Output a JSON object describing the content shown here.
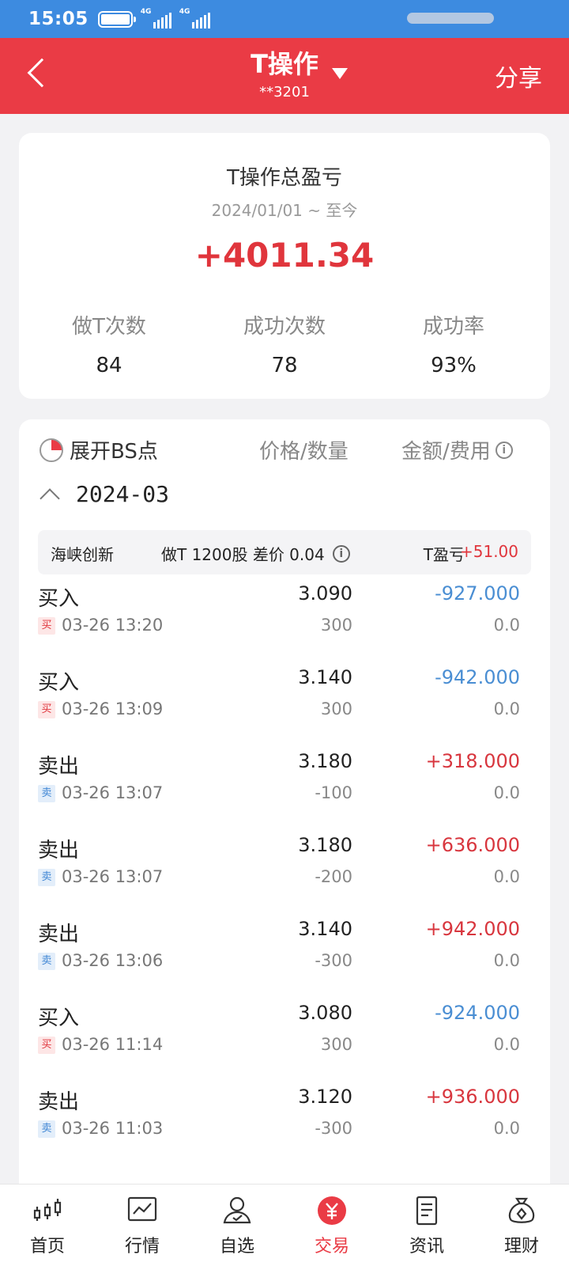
{
  "status_bar": {
    "time": "15:05",
    "net1": "4G",
    "net2": "4G"
  },
  "header": {
    "title": "T操作",
    "account": "**3201",
    "share": "分享"
  },
  "summary": {
    "title": "T操作总盈亏",
    "period": "2024/01/01 ~ 至今",
    "total_pl": "+4011.34",
    "stats": [
      {
        "label": "做T次数",
        "value": "84"
      },
      {
        "label": "成功次数",
        "value": "78"
      },
      {
        "label": "成功率",
        "value": "93%"
      }
    ]
  },
  "detail": {
    "expand_label": "展开BS点",
    "col_price_qty": "价格/数量",
    "col_amount_fee": "金额/费用",
    "month": "2024-03",
    "stock": {
      "name": "海峡创新",
      "desc": "做T 1200股 差价 0.04",
      "pl_label": "T盈亏",
      "pl_value": "+51.00"
    },
    "trades": [
      {
        "type": "买入",
        "badge": "买",
        "time": "03-26 13:20",
        "price": "3.090",
        "qty": "300",
        "amount": "-927.000",
        "fee": "0.0",
        "side": "buy"
      },
      {
        "type": "买入",
        "badge": "买",
        "time": "03-26 13:09",
        "price": "3.140",
        "qty": "300",
        "amount": "-942.000",
        "fee": "0.0",
        "side": "buy"
      },
      {
        "type": "卖出",
        "badge": "卖",
        "time": "03-26 13:07",
        "price": "3.180",
        "qty": "-100",
        "amount": "+318.000",
        "fee": "0.0",
        "side": "sell"
      },
      {
        "type": "卖出",
        "badge": "卖",
        "time": "03-26 13:07",
        "price": "3.180",
        "qty": "-200",
        "amount": "+636.000",
        "fee": "0.0",
        "side": "sell"
      },
      {
        "type": "卖出",
        "badge": "卖",
        "time": "03-26 13:06",
        "price": "3.140",
        "qty": "-300",
        "amount": "+942.000",
        "fee": "0.0",
        "side": "sell"
      },
      {
        "type": "买入",
        "badge": "买",
        "time": "03-26 11:14",
        "price": "3.080",
        "qty": "300",
        "amount": "-924.000",
        "fee": "0.0",
        "side": "buy"
      },
      {
        "type": "卖出",
        "badge": "卖",
        "time": "03-26 11:03",
        "price": "3.120",
        "qty": "-300",
        "amount": "+936.000",
        "fee": "0.0",
        "side": "sell"
      }
    ]
  },
  "nav": [
    {
      "label": "首页",
      "icon": "candlestick-icon"
    },
    {
      "label": "行情",
      "icon": "market-chart-icon"
    },
    {
      "label": "自选",
      "icon": "user-favorite-icon"
    },
    {
      "label": "交易",
      "icon": "yuan-icon",
      "active": true
    },
    {
      "label": "资讯",
      "icon": "document-icon"
    },
    {
      "label": "理财",
      "icon": "money-bag-icon"
    }
  ],
  "colors": {
    "brand_red": "#ea3b45",
    "status_blue": "#3d8be0",
    "positive": "#d8363e",
    "negative": "#4a8ed3"
  }
}
